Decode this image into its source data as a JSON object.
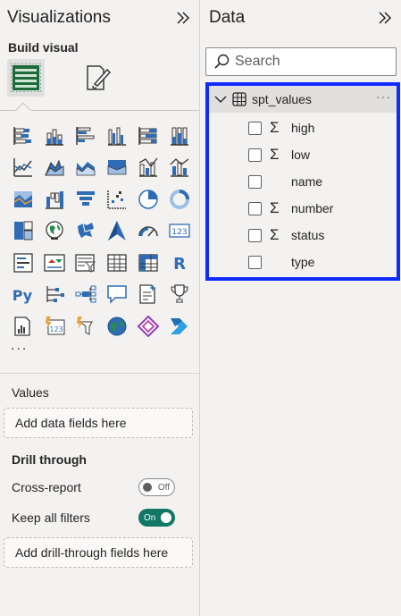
{
  "visualizations": {
    "title": "Visualizations",
    "build_visual_label": "Build visual",
    "more_label": "...",
    "values_label": "Values",
    "values_drop": "Add data fields here",
    "drill_through_label": "Drill through",
    "cross_report_label": "Cross-report",
    "cross_report_state": "Off",
    "keep_filters_label": "Keep all filters",
    "keep_filters_state": "On",
    "drill_drop": "Add drill-through fields here",
    "icon_rows": [
      [
        "stacked-bar-chart",
        "stacked-column-chart",
        "clustered-bar-chart",
        "clustered-column-chart",
        "100-stacked-bar-chart",
        "100-stacked-column-chart"
      ],
      [
        "line-chart",
        "area-chart",
        "stacked-area-chart",
        "ribbon-chart",
        "line-clustered-column-chart",
        "line-stacked-column-chart"
      ],
      [
        "line-area-combo-chart",
        "waterfall-chart",
        "funnel-chart",
        "scatter-chart",
        "pie-chart",
        "donut-chart"
      ],
      [
        "treemap",
        "map",
        "filled-map",
        "azure-map",
        "gauge",
        "card"
      ],
      [
        "multi-row-card",
        "kpi",
        "slicer",
        "table",
        "matrix",
        "r-visual"
      ],
      [
        "python-visual",
        "key-influencers",
        "decomposition-tree",
        "qa-visual",
        "smart-narrative",
        "goals"
      ],
      [
        "paginated-report",
        "power-apps",
        "power-automate",
        "arcgis-map",
        "custom-visual-diamond",
        "power-automate-chevron"
      ]
    ]
  },
  "data": {
    "title": "Data",
    "search_placeholder": "Search",
    "table": {
      "name": "spt_values",
      "more": "···",
      "fields": [
        {
          "name": "high",
          "sigma": "Σ"
        },
        {
          "name": "low",
          "sigma": "Σ"
        },
        {
          "name": "name",
          "sigma": ""
        },
        {
          "name": "number",
          "sigma": "Σ"
        },
        {
          "name": "status",
          "sigma": "Σ"
        },
        {
          "name": "type",
          "sigma": ""
        }
      ]
    }
  },
  "colors": {
    "accent_green": "#117865",
    "highlight_blue": "#0f2bff",
    "icon_blue": "#2f6cb5",
    "icon_dark": "#3b3a39"
  }
}
